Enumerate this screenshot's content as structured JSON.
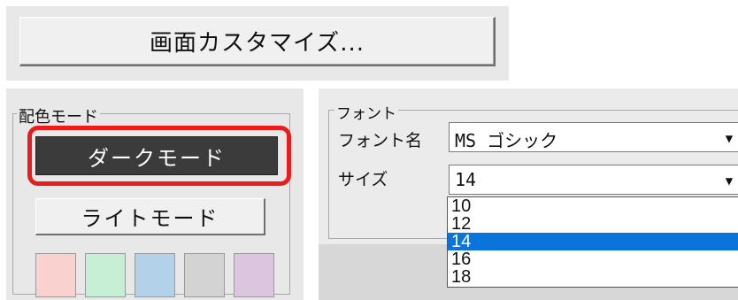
{
  "top": {
    "customize_label": "画面カスタマイズ..."
  },
  "color_mode": {
    "group_label": "配色モード",
    "dark_label": "ダークモード",
    "light_label": "ライトモード",
    "swatches": [
      {
        "name": "pink",
        "color": "#f9d1cf"
      },
      {
        "name": "green",
        "color": "#c6efd5"
      },
      {
        "name": "blue",
        "color": "#b3d2ea"
      },
      {
        "name": "gray",
        "color": "#d3d3d3"
      },
      {
        "name": "lavender",
        "color": "#dcc5df"
      }
    ],
    "highlight_color": "#ea1c1c"
  },
  "font": {
    "group_label": "フォント",
    "name_label": "フォント名",
    "name_value": "MS ゴシック",
    "size_label": "サイズ",
    "size_value": "14",
    "size_options": [
      "10",
      "12",
      "14",
      "16",
      "18"
    ],
    "selected_size": "14"
  }
}
